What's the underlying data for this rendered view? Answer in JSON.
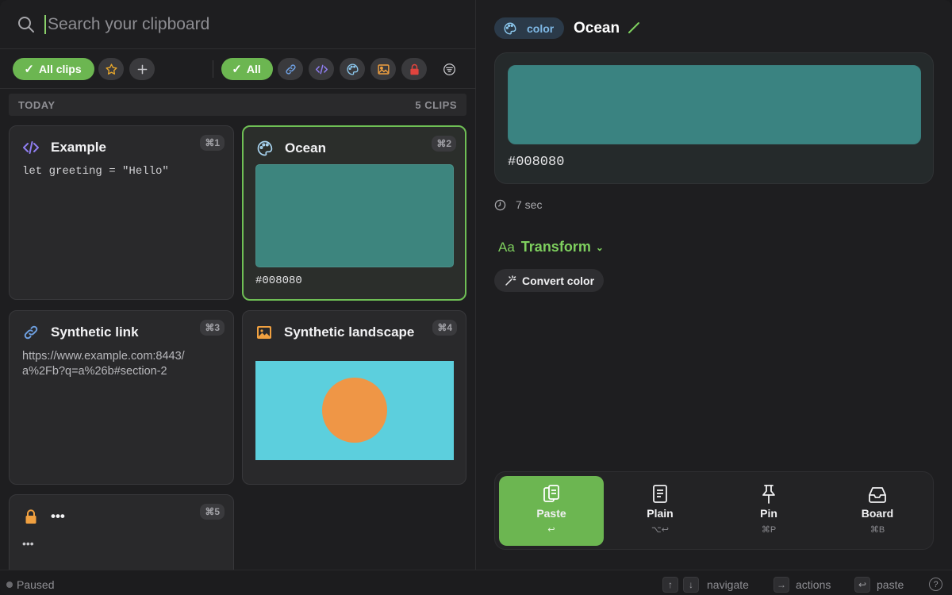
{
  "search": {
    "placeholder": "Search your clipboard"
  },
  "filters": {
    "left_pill": "All clips",
    "type_pill": "All"
  },
  "section": {
    "label": "TODAY",
    "count": "5 CLIPS"
  },
  "clips": [
    {
      "title": "Example",
      "shortcut": "⌘1",
      "icon": "code-icon",
      "content": "let greeting = \"Hello\""
    },
    {
      "title": "Ocean",
      "shortcut": "⌘2",
      "icon": "palette-icon",
      "color": "#3d857e",
      "hex": "#008080"
    },
    {
      "title": "Synthetic link",
      "shortcut": "⌘3",
      "icon": "link-icon",
      "content_line1": "https://www.example.com:8443/",
      "content_line2": "a%2Fb?q=a%26b#section-2"
    },
    {
      "title": "Synthetic landscape",
      "shortcut": "⌘4",
      "icon": "image-icon"
    },
    {
      "title": "•••",
      "shortcut": "⌘5",
      "icon": "lock-icon",
      "content": "•••"
    }
  ],
  "detail": {
    "type_tag": "color",
    "title": "Ocean",
    "swatch_color": "#3a8381",
    "hex": "#008080",
    "time": "7 sec",
    "transform_label": "Transform",
    "transform_aa": "Aa",
    "convert_label": "Convert color"
  },
  "actions": [
    {
      "label": "Paste",
      "key": "↩"
    },
    {
      "label": "Plain",
      "key": "⌥↩"
    },
    {
      "label": "Pin",
      "key": "⌘P"
    },
    {
      "label": "Board",
      "key": "⌘B"
    }
  ],
  "status": {
    "paused": "Paused",
    "navigate": "navigate",
    "actions": "actions",
    "paste": "paste",
    "help": "?"
  },
  "colors": {
    "accent": "#6cb651",
    "ocean_card": "#3d857e",
    "landscape_sky": "#5ccfdd",
    "landscape_sun": "#ef9646"
  }
}
